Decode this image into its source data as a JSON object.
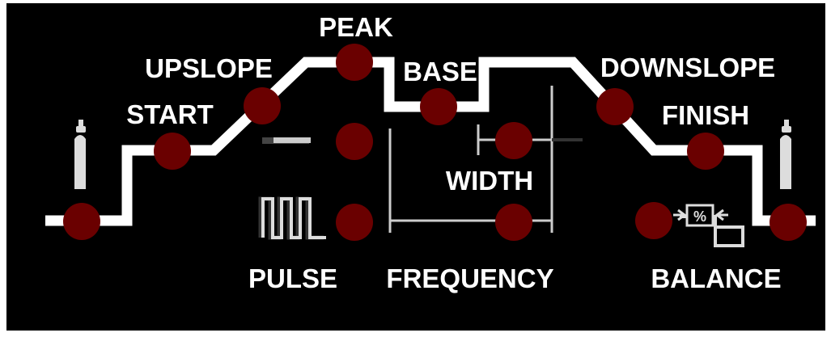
{
  "labels": {
    "peak": "PEAK",
    "upslope": "UPSLOPE",
    "start": "START",
    "base": "BASE",
    "downslope": "DOWNSLOPE",
    "finish": "FINISH",
    "width": "WIDTH",
    "pulse": "PULSE",
    "frequency": "FREQUENCY",
    "balance": "BALANCE",
    "balance_symbol": "%"
  },
  "icons": {
    "gas_pre": "gas-cylinder-icon",
    "gas_post": "gas-cylinder-icon",
    "pulse": "pulse-waveform-icon",
    "balance": "balance-waveform-icon"
  },
  "colors": {
    "panel": "#000000",
    "trace": "#ffffff",
    "led_off": "#6a0000",
    "dim_graphic": "#cccccc"
  }
}
